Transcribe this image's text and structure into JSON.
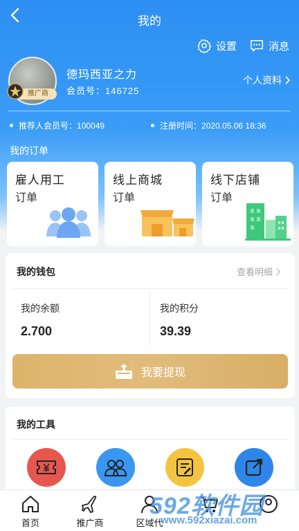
{
  "header": {
    "title": "我的",
    "settings_label": "设置",
    "messages_label": "消息"
  },
  "user": {
    "name": "德玛西亚之力",
    "member_label": "会员号：",
    "member_no": "146725",
    "badge": "推广商",
    "profile_link": "个人资料"
  },
  "info": {
    "referrer_label": "推荐人会员号：",
    "referrer_no": "100049",
    "reg_label": "注册时间：",
    "reg_time": "2020.05.06 18:36"
  },
  "orders": {
    "title": "我的订单",
    "cards": [
      {
        "title": "雇人用工",
        "sub": "订单",
        "icon": "people-group-icon"
      },
      {
        "title": "线上商城",
        "sub": "订单",
        "icon": "shop-icon"
      },
      {
        "title": "线下店铺",
        "sub": "订单",
        "icon": "building-icon"
      }
    ]
  },
  "wallet": {
    "title": "我的钱包",
    "detail_link": "查看明细",
    "balance_label": "我的余额",
    "balance_value": "2.700",
    "points_label": "我的积分",
    "points_value": "39.39",
    "withdraw_label": "我要提现"
  },
  "tools": {
    "title": "我的工具",
    "items": [
      {
        "icon": "ticket-icon",
        "color": "#e8574f"
      },
      {
        "icon": "team-icon",
        "color": "#3a97ef"
      },
      {
        "icon": "notes-icon",
        "color": "#f4c441"
      },
      {
        "icon": "share-icon",
        "color": "#2e86e8"
      }
    ]
  },
  "tabbar": {
    "items": [
      {
        "label": "首页",
        "icon": "home-icon"
      },
      {
        "label": "推广商",
        "icon": "plane-icon"
      },
      {
        "label": "区域代",
        "icon": "user-icon"
      },
      {
        "label": "",
        "icon": "cart-icon"
      },
      {
        "label": "",
        "icon": "profile-icon"
      }
    ]
  },
  "watermark": {
    "big": "592软件园",
    "small": "www.592xiazai.com"
  },
  "colors": {
    "primary": "#2d8ff2",
    "gold": "#deb46b",
    "green": "#3dc97a",
    "orange": "#f5b84a"
  }
}
